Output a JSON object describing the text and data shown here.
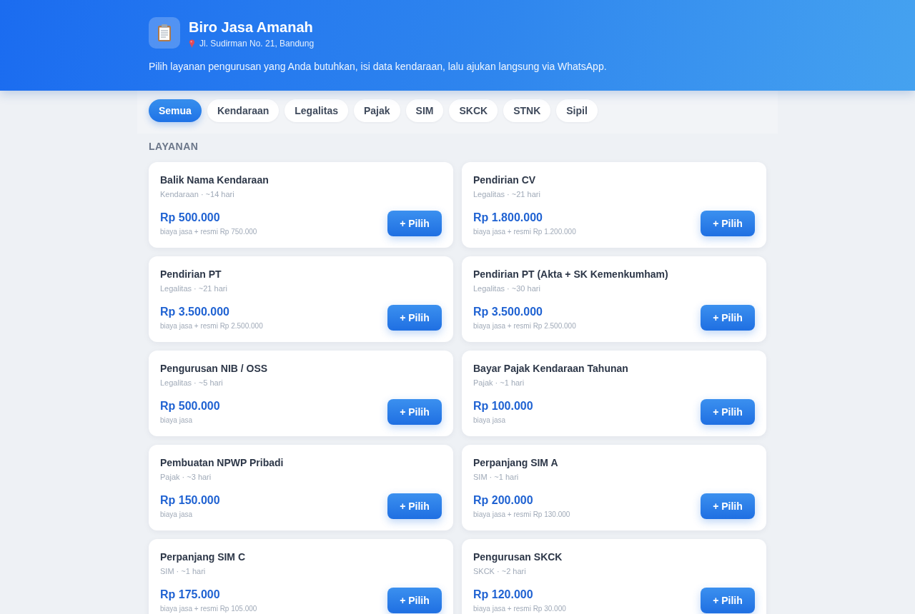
{
  "header": {
    "title": "Biro Jasa Amanah",
    "address": "Jl. Sudirman No. 21, Bandung",
    "description": "Pilih layanan pengurusan yang Anda butuhkan, isi data kendaraan, lalu ajukan langsung via WhatsApp."
  },
  "filter_tabs": [
    {
      "label": "Semua",
      "selected": true
    },
    {
      "label": "Kendaraan",
      "selected": false
    },
    {
      "label": "Legalitas",
      "selected": false
    },
    {
      "label": "Pajak",
      "selected": false
    },
    {
      "label": "SIM",
      "selected": false
    },
    {
      "label": "SKCK",
      "selected": false
    },
    {
      "label": "STNK",
      "selected": false
    },
    {
      "label": "Sipil",
      "selected": false
    }
  ],
  "section_title": "LAYANAN",
  "services": [
    {
      "name": "Balik Nama Kendaraan",
      "meta": "Kendaraan · ~14 hari",
      "price": "Rp 500.000",
      "fee_note": "biaya jasa + resmi Rp 750.000",
      "button": "+ Pilih"
    },
    {
      "name": "Pendirian CV",
      "meta": "Legalitas · ~21 hari",
      "price": "Rp 1.800.000",
      "fee_note": "biaya jasa + resmi Rp 1.200.000",
      "button": "+ Pilih"
    },
    {
      "name": "Pendirian PT",
      "meta": "Legalitas · ~21 hari",
      "price": "Rp 3.500.000",
      "fee_note": "biaya jasa + resmi Rp 2.500.000",
      "button": "+ Pilih"
    },
    {
      "name": "Pendirian PT (Akta + SK Kemenkumham)",
      "meta": "Legalitas · ~30 hari",
      "price": "Rp 3.500.000",
      "fee_note": "biaya jasa + resmi Rp 2.500.000",
      "button": "+ Pilih"
    },
    {
      "name": "Pengurusan NIB / OSS",
      "meta": "Legalitas · ~5 hari",
      "price": "Rp 500.000",
      "fee_note": "biaya jasa",
      "button": "+ Pilih"
    },
    {
      "name": "Bayar Pajak Kendaraan Tahunan",
      "meta": "Pajak · ~1 hari",
      "price": "Rp 100.000",
      "fee_note": "biaya jasa",
      "button": "+ Pilih"
    },
    {
      "name": "Pembuatan NPWP Pribadi",
      "meta": "Pajak · ~3 hari",
      "price": "Rp 150.000",
      "fee_note": "biaya jasa",
      "button": "+ Pilih"
    },
    {
      "name": "Perpanjang SIM A",
      "meta": "SIM · ~1 hari",
      "price": "Rp 200.000",
      "fee_note": "biaya jasa + resmi Rp 130.000",
      "button": "+ Pilih"
    },
    {
      "name": "Perpanjang SIM C",
      "meta": "SIM · ~1 hari",
      "price": "Rp 175.000",
      "fee_note": "biaya jasa + resmi Rp 105.000",
      "button": "+ Pilih"
    },
    {
      "name": "Pengurusan SKCK",
      "meta": "SKCK · ~2 hari",
      "price": "Rp 120.000",
      "fee_note": "biaya jasa + resmi Rp 30.000",
      "button": "+ Pilih"
    }
  ]
}
